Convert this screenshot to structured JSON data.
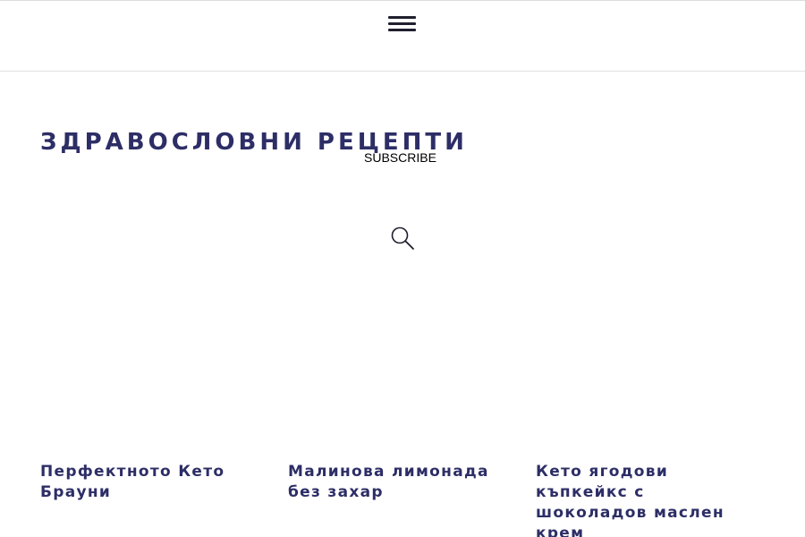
{
  "colors": {
    "brand": "#2d2e66",
    "menu_icon": "#1f1f2e",
    "divider": "#e2e2e2"
  },
  "header": {
    "menu_icon": "hamburger-menu-icon"
  },
  "site": {
    "title": "ЗДРАВОСЛОВНИ РЕЦЕПТИ",
    "subscribe_label": "SUBSCRIBE"
  },
  "search": {
    "icon": "search-icon"
  },
  "recipes": [
    {
      "title": "Перфектното Кето Брауни"
    },
    {
      "title": "Малинова лимонада без захар"
    },
    {
      "title": "Кето ягодови къпкейкс с шоколадов маслен крем"
    }
  ]
}
